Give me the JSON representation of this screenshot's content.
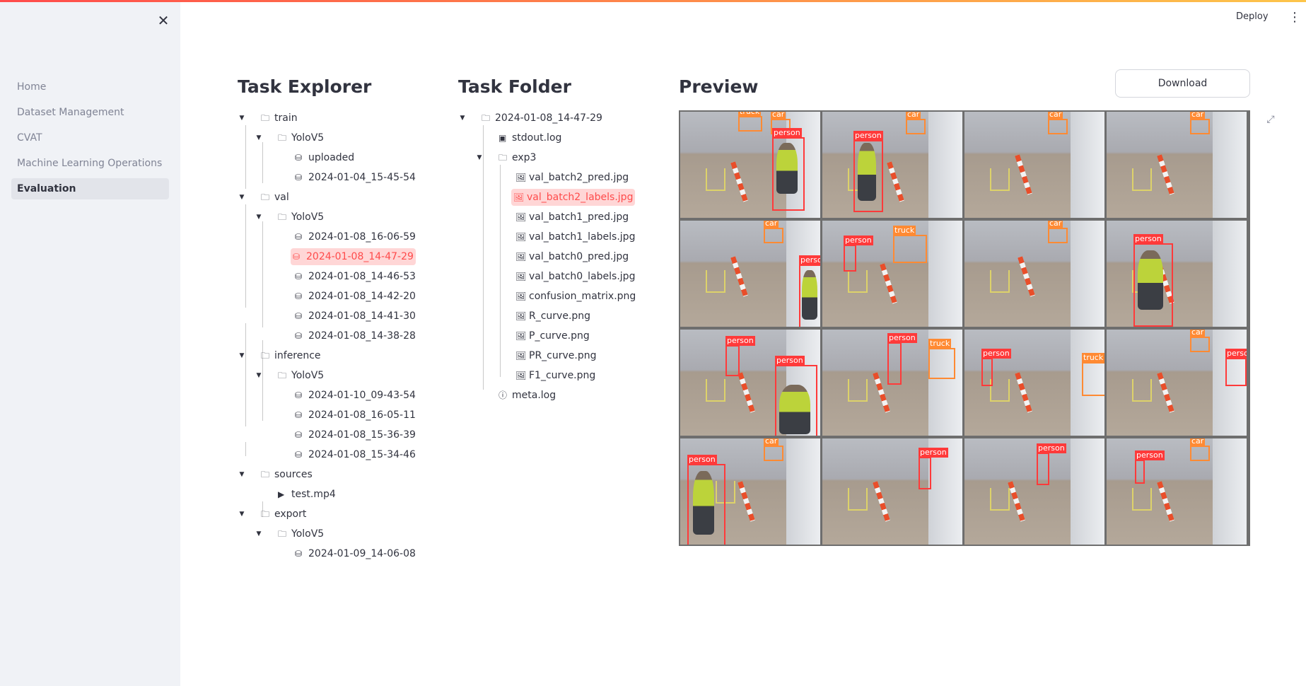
{
  "header": {
    "deploy_label": "Deploy"
  },
  "sidebar": {
    "items": [
      {
        "label": "Home"
      },
      {
        "label": "Dataset Management"
      },
      {
        "label": "CVAT"
      },
      {
        "label": "Machine Learning Operations"
      },
      {
        "label": "Evaluation"
      }
    ]
  },
  "explorer": {
    "title": "Task Explorer",
    "rows": [
      {
        "label": "train"
      },
      {
        "label": "YoloV5"
      },
      {
        "label": "uploaded"
      },
      {
        "label": "2024-01-04_15-45-54"
      },
      {
        "label": "val"
      },
      {
        "label": "YoloV5"
      },
      {
        "label": "2024-01-08_16-06-59"
      },
      {
        "label": "2024-01-08_14-47-29"
      },
      {
        "label": "2024-01-08_14-46-53"
      },
      {
        "label": "2024-01-08_14-42-20"
      },
      {
        "label": "2024-01-08_14-41-30"
      },
      {
        "label": "2024-01-08_14-38-28"
      },
      {
        "label": "inference"
      },
      {
        "label": "YoloV5"
      },
      {
        "label": "2024-01-10_09-43-54"
      },
      {
        "label": "2024-01-08_16-05-11"
      },
      {
        "label": "2024-01-08_15-36-39"
      },
      {
        "label": "2024-01-08_15-34-46"
      },
      {
        "label": "sources"
      },
      {
        "label": "test.mp4"
      },
      {
        "label": "export"
      },
      {
        "label": "YoloV5"
      },
      {
        "label": "2024-01-09_14-06-08"
      }
    ]
  },
  "folder": {
    "title": "Task Folder",
    "rows": [
      {
        "label": "2024-01-08_14-47-29"
      },
      {
        "label": "stdout.log"
      },
      {
        "label": "exp3"
      },
      {
        "label": "val_batch2_pred.jpg"
      },
      {
        "label": "val_batch2_labels.jpg"
      },
      {
        "label": "val_batch1_pred.jpg"
      },
      {
        "label": "val_batch1_labels.jpg"
      },
      {
        "label": "val_batch0_pred.jpg"
      },
      {
        "label": "val_batch0_labels.jpg"
      },
      {
        "label": "confusion_matrix.png"
      },
      {
        "label": "R_curve.png"
      },
      {
        "label": "P_curve.png"
      },
      {
        "label": "PR_curve.png"
      },
      {
        "label": "F1_curve.png"
      },
      {
        "label": "meta.log"
      }
    ]
  },
  "preview": {
    "title": "Preview",
    "download_label": "Download",
    "label_person": "person",
    "label_truck": "truck",
    "label_car": "car"
  }
}
